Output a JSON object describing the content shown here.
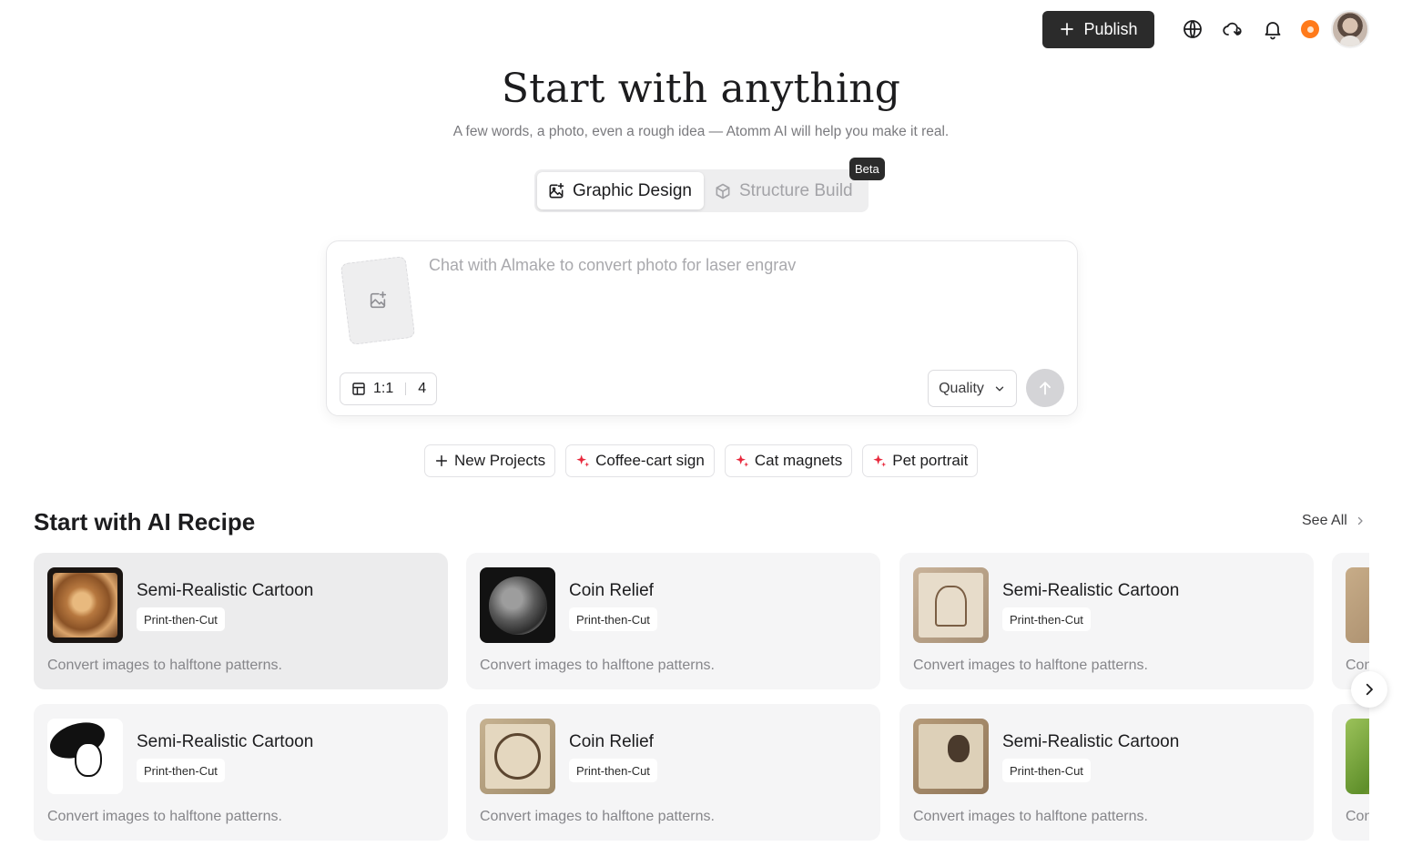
{
  "header": {
    "publish_label": "Publish",
    "icons": [
      "plus-icon",
      "globe-icon",
      "cloud-sync-icon",
      "bell-icon",
      "status-dot-icon",
      "avatar"
    ]
  },
  "hero": {
    "title": "Start with anything",
    "subtitle": "A few words, a photo, even a rough idea — Atomm AI will help you make it real."
  },
  "modes": {
    "graphic_design": "Graphic Design",
    "structure_build": "Structure Build",
    "beta": "Beta",
    "active": "Graphic Design"
  },
  "chat": {
    "placeholder": "Chat with Almake to convert photo for laser engrav",
    "ratio": "1:1",
    "count": "4",
    "quality": "Quality"
  },
  "chips": [
    {
      "label": "New Projects",
      "icon": "plus-icon"
    },
    {
      "label": "Coffee-cart sign",
      "icon": "sparkle-icon"
    },
    {
      "label": "Cat magnets",
      "icon": "sparkle-icon"
    },
    {
      "label": "Pet portrait",
      "icon": "sparkle-icon"
    }
  ],
  "recipes": {
    "title": "Start with AI Recipe",
    "see_all": "See All",
    "cards": [
      {
        "title": "Semi-Realistic Cartoon",
        "tag": "Print-then-Cut",
        "desc": "Convert images to halftone patterns."
      },
      {
        "title": "Coin Relief",
        "tag": "Print-then-Cut",
        "desc": "Convert images to halftone patterns."
      },
      {
        "title": "Semi-Realistic Cartoon",
        "tag": "Print-then-Cut",
        "desc": "Convert images to halftone patterns."
      },
      {
        "title": "Semi-Realistic Cartoon",
        "tag": "Print-then-Cut",
        "desc": "Convert images to halftone patterns."
      },
      {
        "title": "Coin Relief",
        "tag": "Print-then-Cut",
        "desc": "Convert images to halftone patterns."
      },
      {
        "title": "Semi-Realistic Cartoon",
        "tag": "Print-then-Cut",
        "desc": "Convert images to halftone patterns."
      }
    ],
    "partial_desc_1": "Con",
    "partial_desc_2": "Con"
  },
  "colors": {
    "publish_bg": "#2b2b2b",
    "sparkle": "#e8283c",
    "status_dot": "#ff7a1a",
    "card_bg": "#f5f5f6"
  }
}
